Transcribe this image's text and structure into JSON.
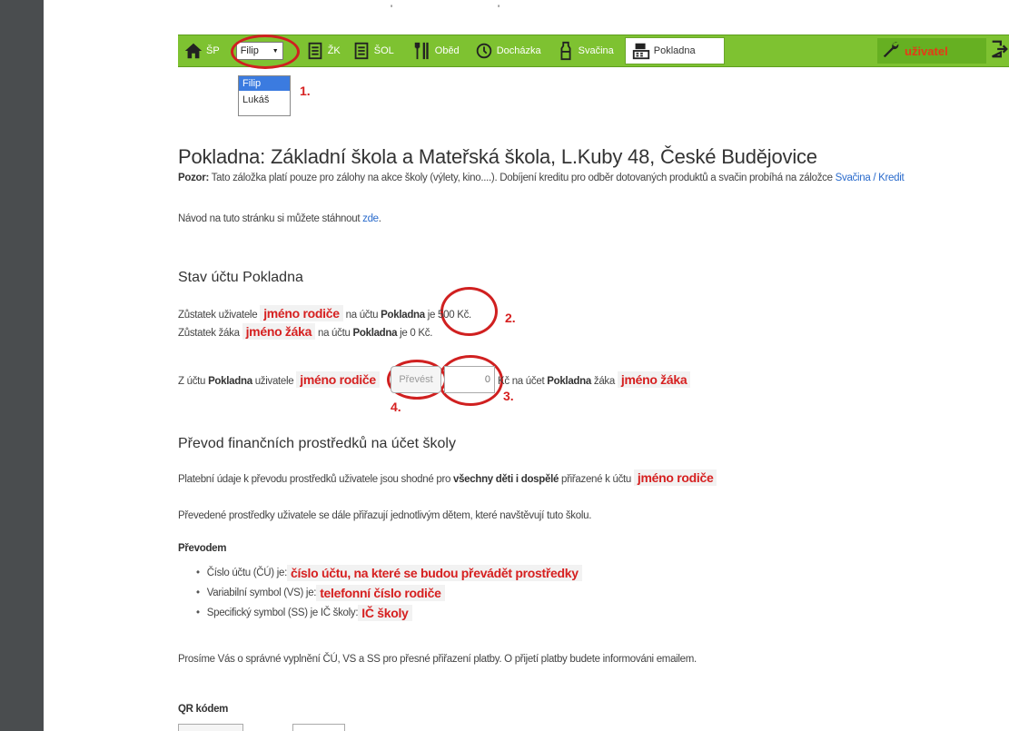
{
  "top_marks": [
    "'",
    "'"
  ],
  "nav": {
    "home_label": "ŠP",
    "child_select_value": "Filip",
    "items": [
      "ŽK",
      "ŠOL",
      "Oběd",
      "Docházka",
      "Svačina",
      "Pokladna"
    ],
    "user_label": "uživatel"
  },
  "dropdown": {
    "options": [
      "Filip",
      "Lukáš"
    ]
  },
  "annotations": {
    "n1": "1.",
    "n2": "2.",
    "n3": "3.",
    "n4": "4."
  },
  "page": {
    "title": "Pokladna: Základní škola a Mateřská škola, L.Kuby 48, České Budějovice",
    "warning_bold": "Pozor:",
    "warning_text": " Tato záložka platí pouze pro zálohy na akce školy (výlety, kino....). Dobíjení kreditu pro odběr dotovaných produktů a svačin probíhá na záložce ",
    "warning_link": "Svačina / Kredit",
    "guide_text": "Návod na tuto stránku si můžete stáhnout ",
    "guide_link": "zde",
    "guide_end": "."
  },
  "account": {
    "heading": "Stav účtu Pokladna",
    "line1_a": "Zůstatek uživatele ",
    "parent_name": "jméno rodiče",
    "line1_b": " na účtu ",
    "account_name": "Pokladna",
    "line1_c": " je ",
    "parent_balance": "500 Kč.",
    "line2_a": "Zůstatek žáka ",
    "student_name": "jméno žáka",
    "line2_c": " je  ",
    "student_balance": "0",
    "currency": " Kč.",
    "transfer_a": "Z účtu ",
    "transfer_b": " uživatele ",
    "transfer_button": "Převést",
    "transfer_value": "0",
    "transfer_c": "Kč na účet ",
    "transfer_d": " žáka "
  },
  "school_transfer": {
    "heading": "Převod finančních prostředků na účet školy",
    "p1_a": "Platební údaje k převodu prostředků uživatele jsou shodné pro ",
    "p1_bold": "všechny děti i dospělé",
    "p1_b": " přiřazené k účtu ",
    "p1_red": "jméno rodiče",
    "p2": "Převedené prostředky uživatele se dále přiřazují jednotlivým dětem, které navštěvují tuto školu.",
    "sub_heading": "Převodem",
    "items": [
      {
        "label": "Číslo účtu (ČÚ) je: ",
        "value": "číslo účtu, na které se budou převádět prostředky"
      },
      {
        "label": "Variabilní symbol (VS) je: ",
        "value": "telefonní číslo rodiče"
      },
      {
        "label": "Specifický symbol (SS) je IČ školy: ",
        "value": "IČ školy"
      }
    ],
    "p3": "Prosíme Vás o správné vyplnění ČÚ, VS a SS pro přesné přiřazení platby. O přijetí platby budete informováni emailem.",
    "qr_heading": "QR kódem"
  }
}
